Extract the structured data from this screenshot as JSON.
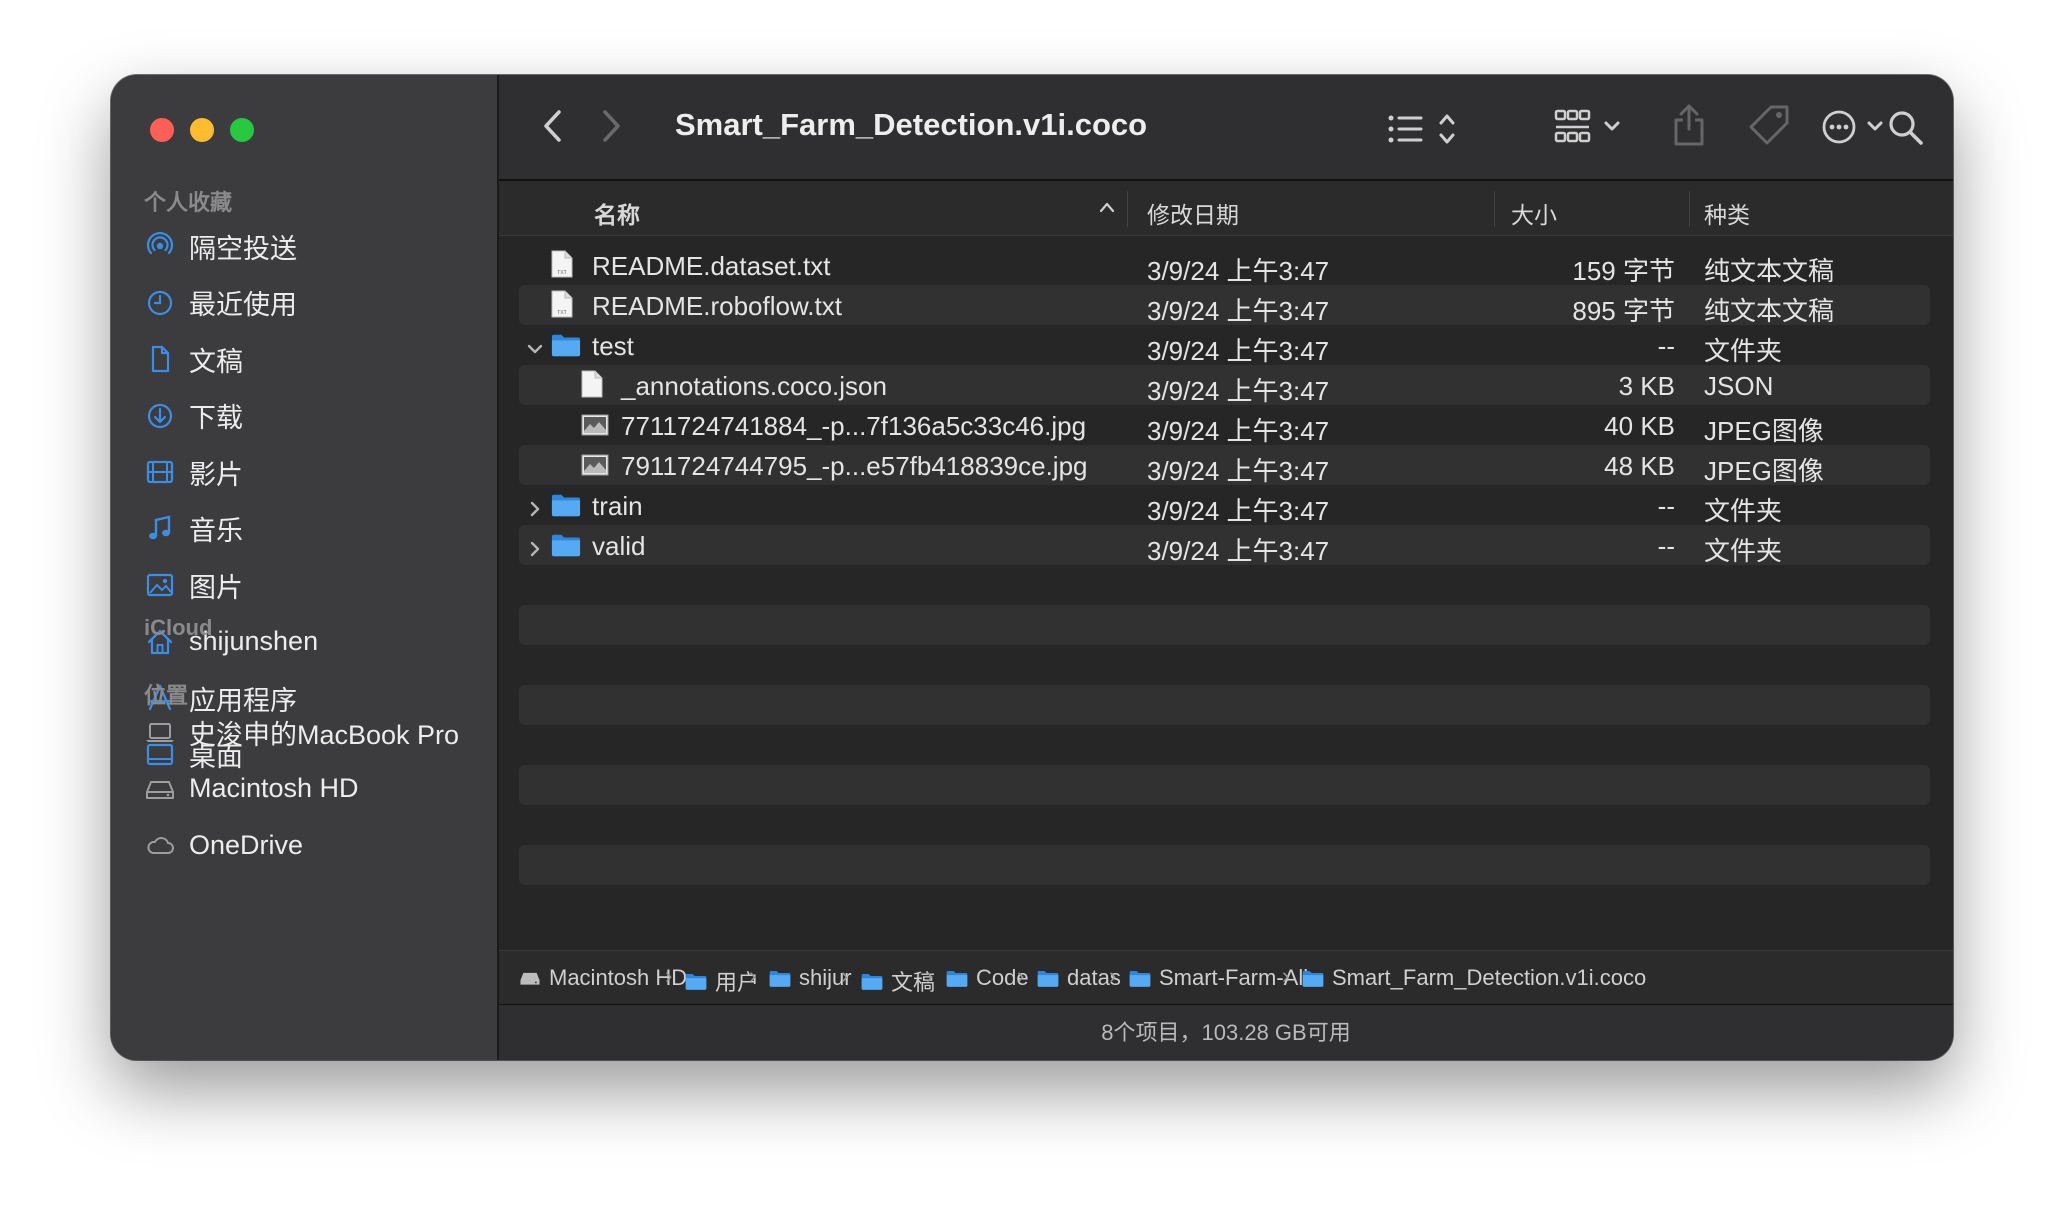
{
  "window": {
    "title": "Smart_Farm_Detection.v1i.coco"
  },
  "sidebar": {
    "favorites_label": "个人收藏",
    "favorites": [
      {
        "label": "隔空投送",
        "icon": "airdrop-icon"
      },
      {
        "label": "最近使用",
        "icon": "clock-icon"
      },
      {
        "label": "文稿",
        "icon": "document-icon"
      },
      {
        "label": "下载",
        "icon": "download-icon"
      },
      {
        "label": "影片",
        "icon": "film-icon"
      },
      {
        "label": "音乐",
        "icon": "music-icon"
      },
      {
        "label": "图片",
        "icon": "photo-icon"
      },
      {
        "label": "shijunshen",
        "icon": "home-icon"
      },
      {
        "label": "应用程序",
        "icon": "applications-icon"
      },
      {
        "label": "桌面",
        "icon": "desktop-icon"
      }
    ],
    "icloud_label": "iCloud",
    "locations_label": "位置",
    "locations": [
      {
        "label": "史浚申的MacBook Pro",
        "icon": "laptop-icon"
      },
      {
        "label": "Macintosh HD",
        "icon": "disk-icon"
      },
      {
        "label": "OneDrive",
        "icon": "cloud-icon"
      }
    ]
  },
  "columns": {
    "name": "名称",
    "date": "修改日期",
    "size": "大小",
    "kind": "种类"
  },
  "files": [
    {
      "name": "README.dataset.txt",
      "date": "3/9/24 上午3:47",
      "size": "159 字节",
      "kind": "纯文本文稿",
      "type": "text",
      "indent": 0,
      "disclosure": ""
    },
    {
      "name": "README.roboflow.txt",
      "date": "3/9/24 上午3:47",
      "size": "895 字节",
      "kind": "纯文本文稿",
      "type": "text",
      "indent": 0,
      "disclosure": ""
    },
    {
      "name": "test",
      "date": "3/9/24 上午3:47",
      "size": "--",
      "kind": "文件夹",
      "type": "folder",
      "indent": 0,
      "disclosure": "open"
    },
    {
      "name": "_annotations.coco.json",
      "date": "3/9/24 上午3:47",
      "size": "3 KB",
      "kind": "JSON",
      "type": "doc",
      "indent": 1,
      "disclosure": ""
    },
    {
      "name": "7711724741884_-p...7f136a5c33c46.jpg",
      "date": "3/9/24 上午3:47",
      "size": "40 KB",
      "kind": "JPEG图像",
      "type": "image",
      "indent": 1,
      "disclosure": ""
    },
    {
      "name": "7911724744795_-p...e57fb418839ce.jpg",
      "date": "3/9/24 上午3:47",
      "size": "48 KB",
      "kind": "JPEG图像",
      "type": "image",
      "indent": 1,
      "disclosure": ""
    },
    {
      "name": "train",
      "date": "3/9/24 上午3:47",
      "size": "--",
      "kind": "文件夹",
      "type": "folder",
      "indent": 0,
      "disclosure": "closed"
    },
    {
      "name": "valid",
      "date": "3/9/24 上午3:47",
      "size": "--",
      "kind": "文件夹",
      "type": "folder",
      "indent": 0,
      "disclosure": "closed"
    }
  ],
  "pathbar": [
    {
      "label": "Macintosh HD",
      "icon": "disk-icon"
    },
    {
      "label": "用户",
      "icon": "folder-icon"
    },
    {
      "label": "shijur",
      "icon": "folder-icon"
    },
    {
      "label": "文稿",
      "icon": "folder-icon"
    },
    {
      "label": "Code",
      "icon": "folder-icon"
    },
    {
      "label": "datas",
      "icon": "folder-icon"
    },
    {
      "label": "Smart-Farm-All",
      "icon": "folder-icon"
    },
    {
      "label": "Smart_Farm_Detection.v1i.coco",
      "icon": "folder-icon"
    }
  ],
  "status": {
    "text": "8个项目，103.28 GB可用"
  },
  "colors": {
    "accent": "#1e90ff",
    "folder": "#3d9be9"
  }
}
